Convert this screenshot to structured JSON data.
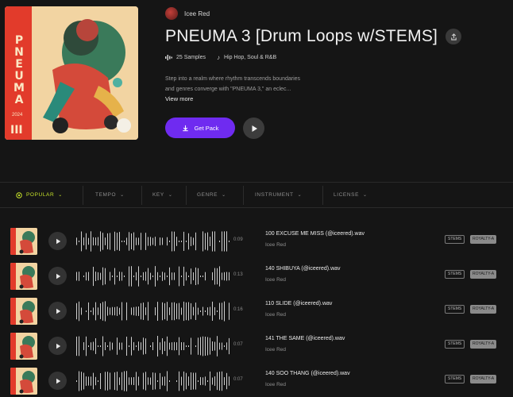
{
  "pack": {
    "author": "Icee Red",
    "title": "PNEUMA 3 [Drum Loops w/STEMS]",
    "samples": "25 Samples",
    "genres": "Hip Hop, Soul & R&B",
    "description_line1": "Step into a realm where rhythm transcends boundaries",
    "description_line2": "and genres converge with \"PNEUMA 3,\" an eclec...",
    "view_more": "View more",
    "get_pack_label": "Get Pack",
    "cover_text": {
      "word": "PNEUMA",
      "numeral": "III",
      "tag": "2024"
    }
  },
  "filters": [
    {
      "label": "POPULAR",
      "active": true
    },
    {
      "label": "TEMPO",
      "active": false
    },
    {
      "label": "KEY",
      "active": false
    },
    {
      "label": "GENRE",
      "active": false
    },
    {
      "label": "INSTRUMENT",
      "active": false
    },
    {
      "label": "LICENSE",
      "active": false
    }
  ],
  "tracks": [
    {
      "title": "100 EXCUSE ME MISS (@iceered).wav",
      "author": "Icee Red",
      "duration": "0:09",
      "stems": "STEMS",
      "royalty": "ROYALTY-A"
    },
    {
      "title": "140 SHIBUYA (@iceered).wav",
      "author": "Icee Red",
      "duration": "0:13",
      "stems": "STEMS",
      "royalty": "ROYALTY-A"
    },
    {
      "title": "110 SLIDE (@iceered).wav",
      "author": "Icee Red",
      "duration": "0:16",
      "stems": "STEMS",
      "royalty": "ROYALTY-A"
    },
    {
      "title": "141 THE SAME (@iceered).wav",
      "author": "Icee Red",
      "duration": "0:07",
      "stems": "STEMS",
      "royalty": "ROYALTY-A"
    },
    {
      "title": "140 SOO THANG (@iceered).wav",
      "author": "Icee Red",
      "duration": "0:07",
      "stems": "STEMS",
      "royalty": "ROYALTY-A"
    }
  ],
  "colors": {
    "accent": "#6f2bf0",
    "active_filter": "#c6e22a",
    "background": "#151515"
  },
  "icons": {
    "share": "share-icon",
    "samples": "waveform-icon",
    "genre": "music-note-icon",
    "download": "download-icon",
    "play": "play-icon",
    "filter_active": "target-icon",
    "dropdown": "chevron-down-icon"
  }
}
